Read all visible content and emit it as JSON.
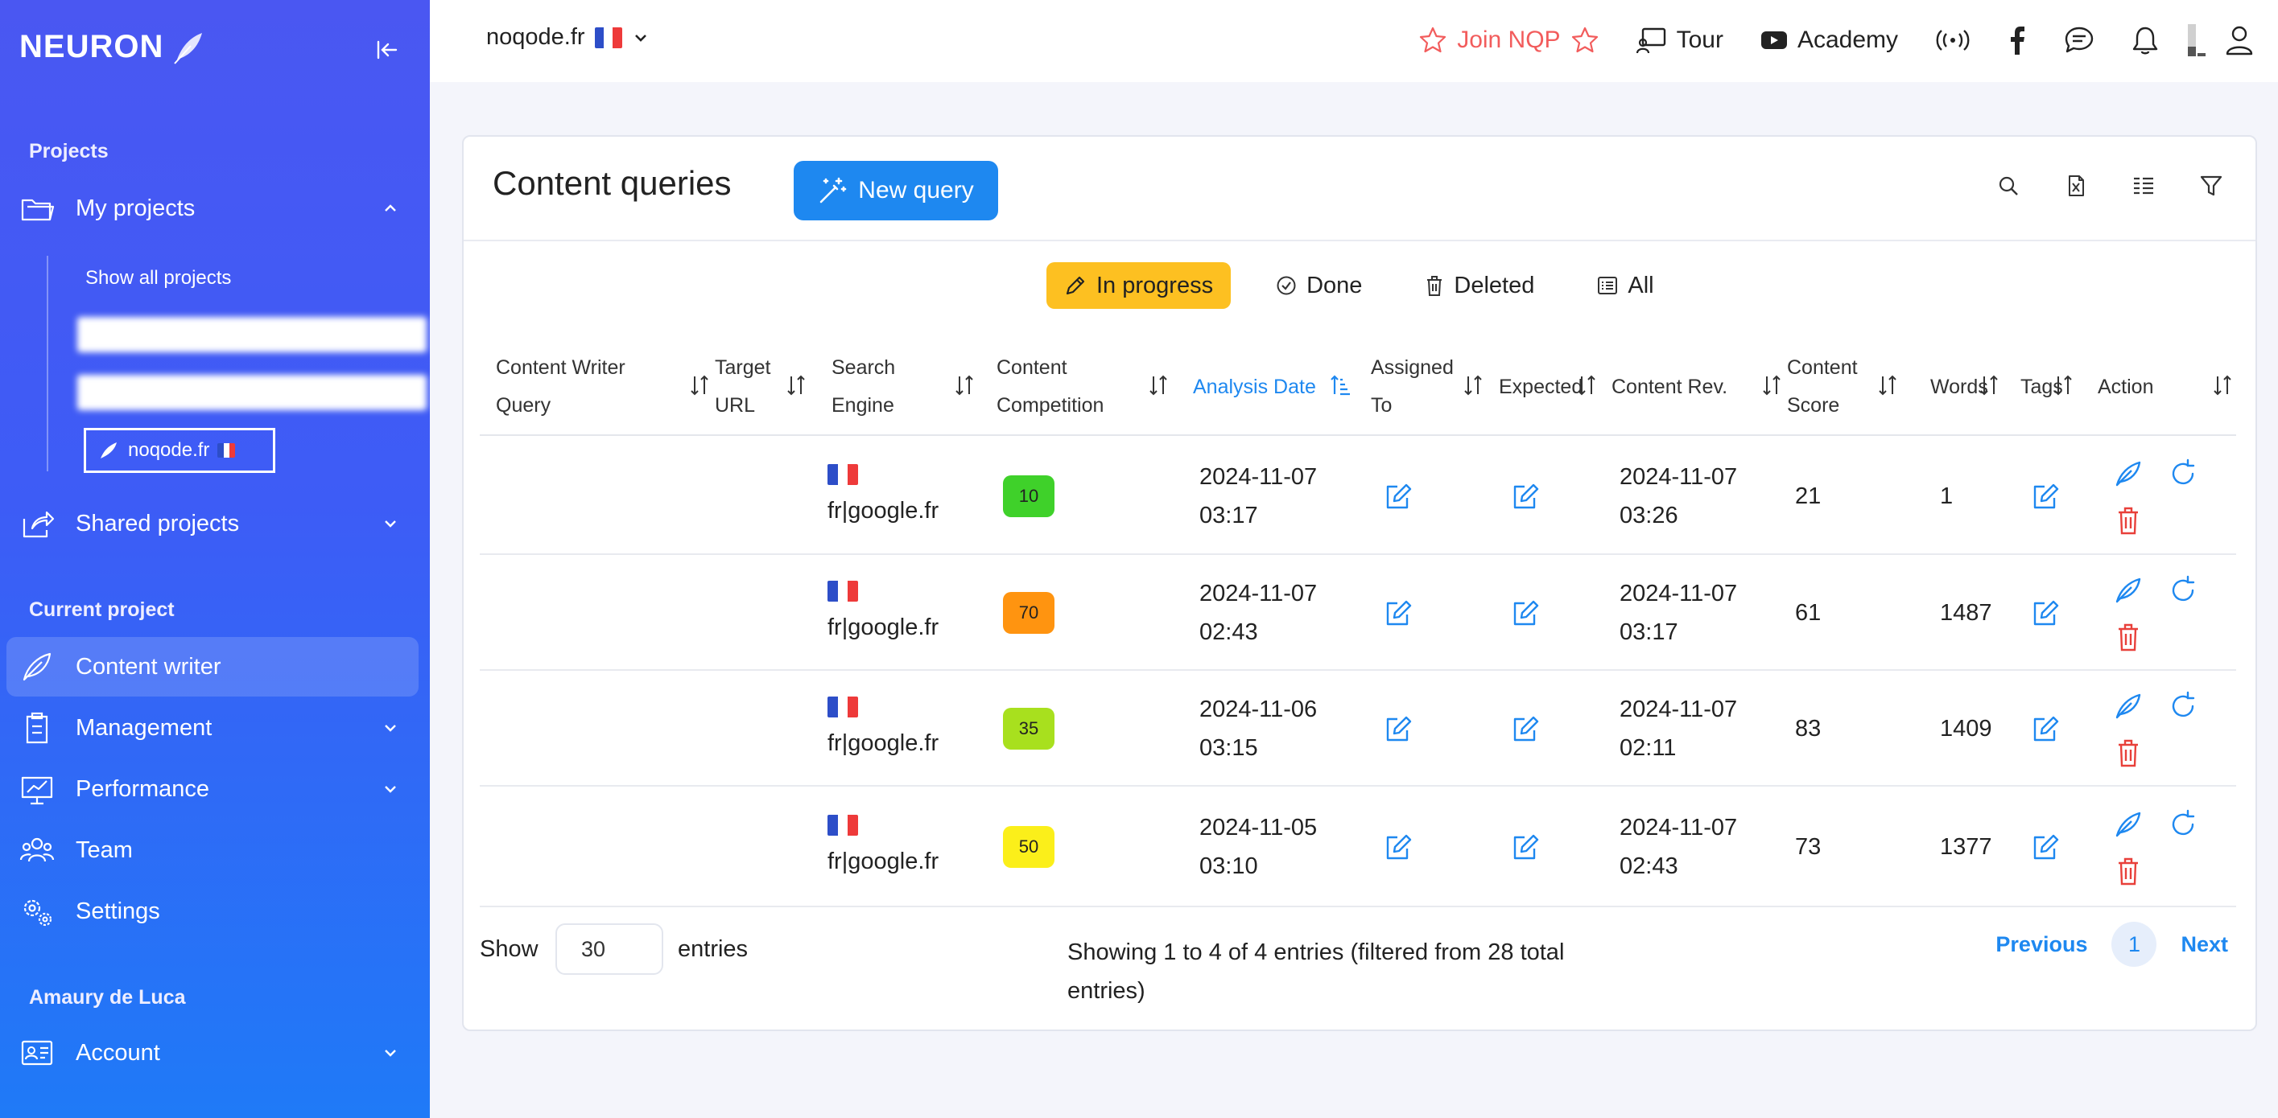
{
  "sidebar": {
    "logo": "NEURON",
    "sections": {
      "projects": "Projects",
      "current_project": "Current project",
      "user": "Amaury de Luca"
    },
    "my_projects": "My projects",
    "show_all_projects": "Show all projects",
    "active_project": "noqode.fr",
    "shared_projects": "Shared projects",
    "items": {
      "content_writer": "Content writer",
      "management": "Management",
      "performance": "Performance",
      "team": "Team",
      "settings": "Settings",
      "account": "Account"
    }
  },
  "topbar": {
    "site": "noqode.fr",
    "join": "Join NQP",
    "tour": "Tour",
    "academy": "Academy"
  },
  "card": {
    "title": "Content queries",
    "new_query": "New query",
    "filters": {
      "in_progress": "In progress",
      "done": "Done",
      "deleted": "Deleted",
      "all": "All"
    },
    "columns": {
      "query": [
        "Content Writer",
        "Query"
      ],
      "target": [
        "Target",
        "URL"
      ],
      "engine": "Search Engine",
      "competition": [
        "Content",
        "Competition"
      ],
      "analysis": "Analysis Date",
      "assigned": [
        "Assigned",
        "To"
      ],
      "expected": "Expected",
      "rev": "Content Rev.",
      "score": [
        "Content",
        "Score"
      ],
      "words": "Words",
      "tags": "Tags",
      "action": "Action"
    },
    "rows": [
      {
        "engine": "fr|google.fr",
        "competition": "10",
        "analysis_date": "2024-11-07",
        "analysis_time": "03:17",
        "rev_date": "2024-11-07",
        "rev_time": "03:26",
        "score": "21",
        "words": "1"
      },
      {
        "engine": "fr|google.fr",
        "competition": "70",
        "analysis_date": "2024-11-07",
        "analysis_time": "02:43",
        "rev_date": "2024-11-07",
        "rev_time": "03:17",
        "score": "61",
        "words": "1487"
      },
      {
        "engine": "fr|google.fr",
        "competition": "35",
        "analysis_date": "2024-11-06",
        "analysis_time": "03:15",
        "rev_date": "2024-11-07",
        "rev_time": "02:11",
        "score": "83",
        "words": "1409"
      },
      {
        "engine": "fr|google.fr",
        "competition": "50",
        "analysis_date": "2024-11-05",
        "analysis_time": "03:10",
        "rev_date": "2024-11-07",
        "rev_time": "02:43",
        "score": "73",
        "words": "1377"
      }
    ],
    "footer": {
      "show": "Show",
      "entries_value": "30",
      "entries": "entries",
      "info": "Showing 1 to 4 of 4 entries (filtered from 28 total entries)",
      "previous": "Previous",
      "page": "1",
      "next": "Next"
    }
  },
  "colors": {
    "accent": "#1e88f0",
    "in_progress": "#fdc021",
    "delete": "#e8403a",
    "badge_10": "#3fd12a",
    "badge_70": "#ff9410",
    "badge_35": "#a8e01e",
    "badge_50": "#fbef1a"
  }
}
